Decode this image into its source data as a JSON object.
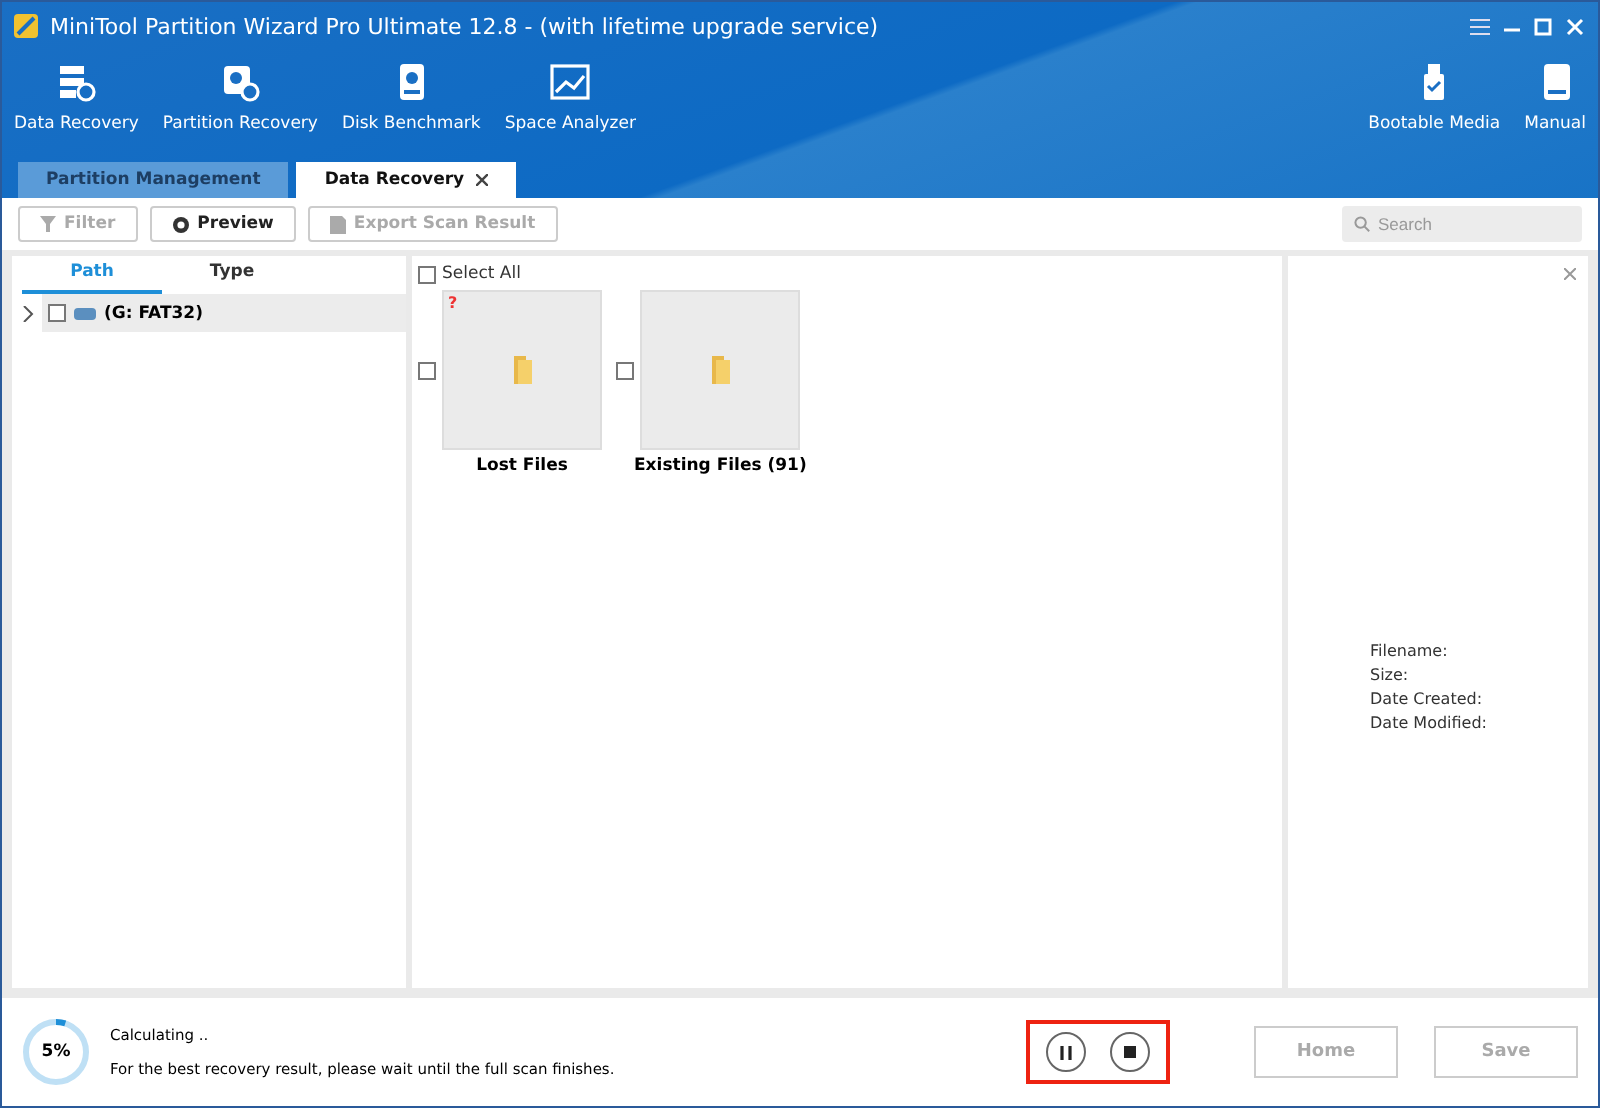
{
  "window": {
    "title": "MiniTool Partition Wizard Pro Ultimate 12.8 - (with lifetime upgrade service)"
  },
  "toolbar": {
    "left": [
      {
        "kind": "data",
        "label": "Data Recovery"
      },
      {
        "kind": "partition",
        "label": "Partition Recovery"
      },
      {
        "kind": "disk",
        "label": "Disk Benchmark"
      },
      {
        "kind": "space",
        "label": "Space Analyzer"
      }
    ],
    "right": [
      {
        "kind": "usb",
        "label": "Bootable Media"
      },
      {
        "kind": "book",
        "label": "Manual"
      }
    ]
  },
  "tabs": [
    {
      "label": "Partition Management",
      "selected": false,
      "closable": false
    },
    {
      "label": "Data Recovery",
      "selected": true,
      "closable": true
    }
  ],
  "actions": [
    {
      "kind": "filter",
      "label": "Filter",
      "disabled": true
    },
    {
      "kind": "preview",
      "label": "Preview",
      "disabled": false
    },
    {
      "kind": "export",
      "label": "Export Scan Result",
      "disabled": true
    }
  ],
  "search": {
    "placeholder": "Search"
  },
  "view_tabs": [
    {
      "label": "Path",
      "selected": true
    },
    {
      "label": "Type",
      "selected": false
    }
  ],
  "tree": [
    {
      "label": "(G: FAT32)",
      "checked": false,
      "expanded": false
    }
  ],
  "select_all": {
    "label": "Select All",
    "checked": false
  },
  "folders": [
    {
      "label": "Lost Files",
      "checked": false,
      "badge": "?"
    },
    {
      "label": "Existing Files (91)",
      "checked": false
    }
  ],
  "details": [
    "Filename:",
    "Size:",
    "Date Created:",
    "Date Modified:"
  ],
  "progress": {
    "reading": "5%",
    "level": 0.05,
    "status": "Calculating ..",
    "note": "For the best recovery result, please wait until the full scan finishes."
  },
  "buttons": [
    {
      "label": "Home",
      "disabled": true
    },
    {
      "label": "Save",
      "disabled": true
    }
  ]
}
